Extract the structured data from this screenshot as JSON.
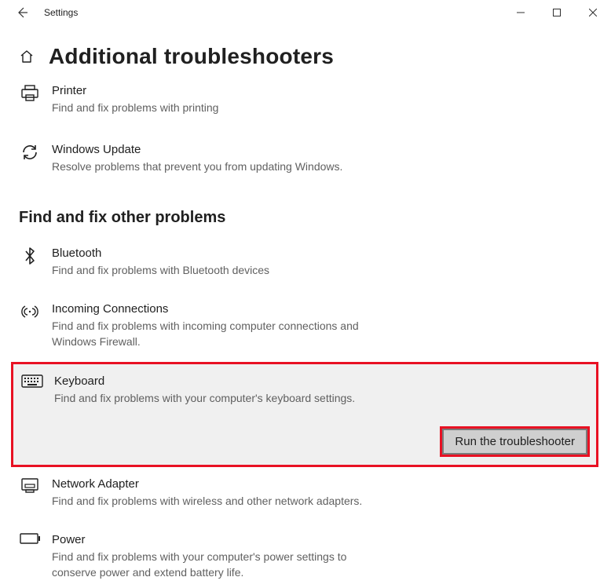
{
  "window": {
    "title": "Settings"
  },
  "page": {
    "title": "Additional troubleshooters"
  },
  "top_items": [
    {
      "title": "Printer",
      "desc": "Find and fix problems with printing"
    },
    {
      "title": "Windows Update",
      "desc": "Resolve problems that prevent you from updating Windows."
    }
  ],
  "section2": {
    "heading": "Find and fix other problems",
    "items": [
      {
        "title": "Bluetooth",
        "desc": "Find and fix problems with Bluetooth devices"
      },
      {
        "title": "Incoming Connections",
        "desc": "Find and fix problems with incoming computer connections and Windows Firewall."
      },
      {
        "title": "Keyboard",
        "desc": "Find and fix problems with your computer's keyboard settings.",
        "button": "Run the troubleshooter"
      },
      {
        "title": "Network Adapter",
        "desc": "Find and fix problems with wireless and other network adapters."
      },
      {
        "title": "Power",
        "desc": "Find and fix problems with your computer's power settings to conserve power and extend battery life."
      }
    ]
  }
}
